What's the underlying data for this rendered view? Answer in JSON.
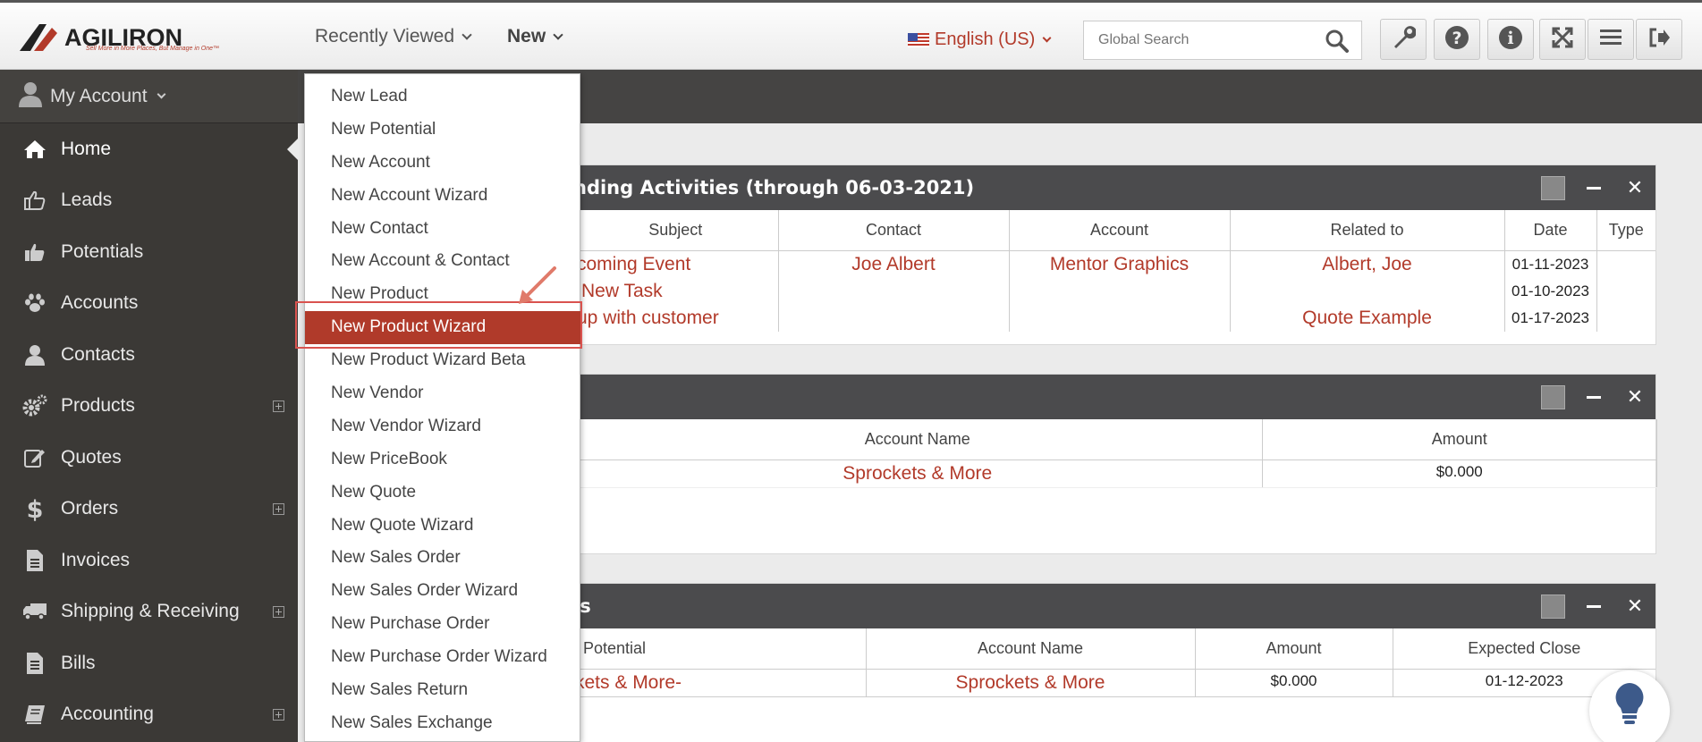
{
  "header": {
    "logo_text": "AGILIRON",
    "logo_tagline": "Sell More in More Places, But Manage in One™",
    "recently_viewed": "Recently Viewed",
    "new_menu": "New",
    "language": "English (US)",
    "search_placeholder": "Global Search",
    "tools": [
      "wrench-icon",
      "help-icon",
      "info-icon",
      "expand-icon",
      "menu-icon",
      "logout-icon"
    ]
  },
  "sidebar": {
    "account_label": "My Account",
    "items": [
      {
        "label": "Home",
        "icon": "home-icon",
        "expandable": false
      },
      {
        "label": "Leads",
        "icon": "thumbs-up-outline-icon",
        "expandable": false
      },
      {
        "label": "Potentials",
        "icon": "thumbs-up-icon",
        "expandable": false
      },
      {
        "label": "Accounts",
        "icon": "paw-icon",
        "expandable": false
      },
      {
        "label": "Contacts",
        "icon": "user-icon",
        "expandable": false
      },
      {
        "label": "Products",
        "icon": "gears-icon",
        "expandable": true
      },
      {
        "label": "Quotes",
        "icon": "edit-icon",
        "expandable": false
      },
      {
        "label": "Orders",
        "icon": "dollar-icon",
        "expandable": true
      },
      {
        "label": "Invoices",
        "icon": "document-icon",
        "expandable": false
      },
      {
        "label": "Shipping & Receiving",
        "icon": "truck-icon",
        "expandable": true
      },
      {
        "label": "Bills",
        "icon": "file-icon",
        "expandable": false
      },
      {
        "label": "Accounting",
        "icon": "book-icon",
        "expandable": true
      }
    ]
  },
  "new_dropdown": {
    "items": [
      "New Lead",
      "New Potential",
      "New Account",
      "New Account Wizard",
      "New Contact",
      "New Account & Contact",
      "New Product",
      "New Product Wizard",
      "New Product Wizard Beta",
      "New Vendor",
      "New Vendor Wizard",
      "New PriceBook",
      "New Quote",
      "New Quote Wizard",
      "New Sales Order",
      "New Sales Order Wizard",
      "New Purchase Order",
      "New Purchase Order Wizard",
      "New Sales Return",
      "New Sales Exchange"
    ],
    "highlighted": "New Product Wizard"
  },
  "panels": {
    "activities": {
      "title": "nding Activities (through 06-03-2021)",
      "headers": [
        "Subject",
        "Contact",
        "Account",
        "Related to",
        "Date",
        "Type"
      ],
      "subjects": [
        "coming Event",
        "New Task",
        "up with customer"
      ],
      "contact": "Joe Albert",
      "account": "Mentor Graphics",
      "related": [
        "Albert, Joe",
        "",
        "Quote Example"
      ],
      "dates": [
        "01-11-2023",
        "01-10-2023",
        "01-17-2023"
      ]
    },
    "accounts": {
      "headers": [
        "Account Name",
        "Amount"
      ],
      "account_name": "Sprockets & More",
      "amount": "$0.000"
    },
    "potentials": {
      "title": "ls",
      "headers": [
        "Potential",
        "Account Name",
        "Amount",
        "Expected Close"
      ],
      "potential": "kets & More-",
      "account_name": "Sprockets & More",
      "amount": "$0.000",
      "expected_close": "01-12-2023"
    }
  }
}
